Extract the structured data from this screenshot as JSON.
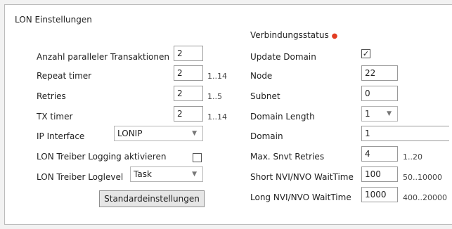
{
  "panel": {
    "title": "LON Einstellungen"
  },
  "left": {
    "transactions": {
      "label": "Anzahl paralleler Transaktionen",
      "value": "2"
    },
    "repeat_timer": {
      "label": "Repeat timer",
      "value": "2",
      "range": "1..14"
    },
    "retries": {
      "label": "Retries",
      "value": "2",
      "range": "1..5"
    },
    "tx_timer": {
      "label": "TX timer",
      "value": "2",
      "range": "1..14"
    },
    "ip_interface": {
      "label": "IP Interface",
      "value": "LONIP"
    },
    "logging": {
      "label": "LON Treiber Logging aktivieren",
      "checked": false
    },
    "loglevel": {
      "label": "LON Treiber Loglevel",
      "value": "Task"
    },
    "defaults_button": "Standardeinstellungen"
  },
  "right": {
    "status": {
      "label": "Verbindungsstatus",
      "indicator_color": "#e23c22"
    },
    "update_domain": {
      "label": "Update Domain",
      "checked": true
    },
    "node": {
      "label": "Node",
      "value": "22"
    },
    "subnet": {
      "label": "Subnet",
      "value": "0"
    },
    "domain_length": {
      "label": "Domain Length",
      "value": "1"
    },
    "domain": {
      "label": "Domain",
      "value": "1"
    },
    "snvt_retries": {
      "label": "Max. Snvt Retries",
      "value": "4",
      "range": "1..20"
    },
    "short_wait": {
      "label": "Short NVI/NVO WaitTime",
      "value": "100",
      "range": "50..10000"
    },
    "long_wait": {
      "label": "Long NVI/NVO WaitTime",
      "value": "1000",
      "range": "400..20000"
    }
  }
}
